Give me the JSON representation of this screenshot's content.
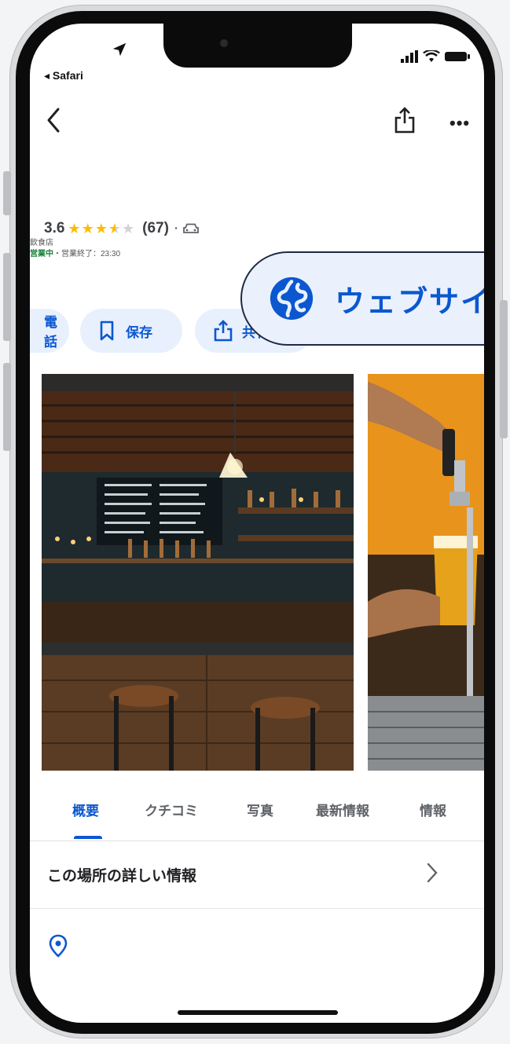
{
  "status_bar": {
    "back_app": "◂ Safari"
  },
  "place": {
    "rating": "3.6",
    "stars": {
      "full": 3,
      "half": 1,
      "empty": 1
    },
    "reviews": "(67)",
    "separator": "·",
    "category": "飲食店",
    "open_status": "営業中",
    "closing": "・営業終了：23:30"
  },
  "actions": {
    "call": "電話",
    "save": "保存",
    "share": "共有",
    "website": "ウェブサイト"
  },
  "tabs": [
    "概要",
    "クチコミ",
    "写真",
    "最新情報",
    "情報"
  ],
  "details": {
    "more_info": "この場所の詳しい情報"
  },
  "colors": {
    "accent": "#0b57d0",
    "pill_bg": "#e8f0fe",
    "star": "#fbbc04",
    "open": "#188038"
  }
}
